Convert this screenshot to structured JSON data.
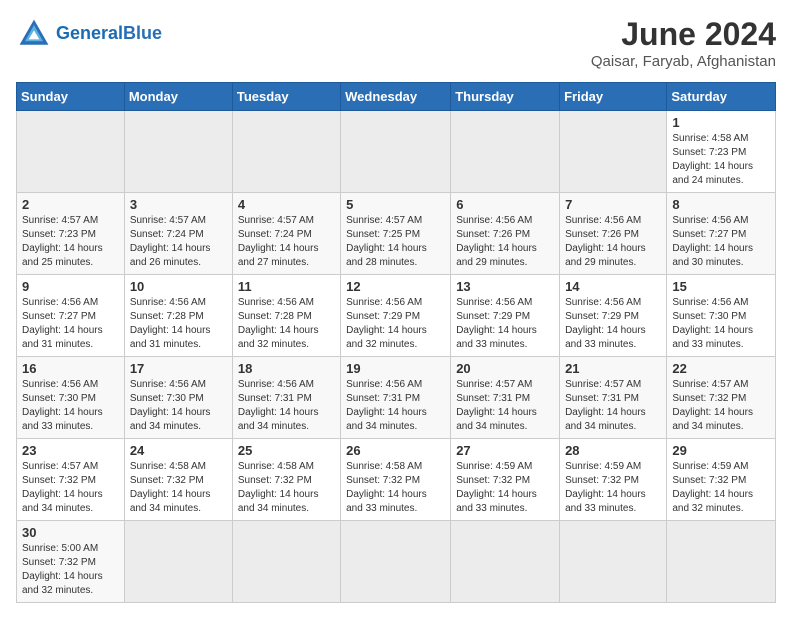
{
  "header": {
    "logo_general": "General",
    "logo_blue": "Blue",
    "month_year": "June 2024",
    "location": "Qaisar, Faryab, Afghanistan"
  },
  "weekdays": [
    "Sunday",
    "Monday",
    "Tuesday",
    "Wednesday",
    "Thursday",
    "Friday",
    "Saturday"
  ],
  "weeks": [
    [
      {
        "day": "",
        "info": ""
      },
      {
        "day": "",
        "info": ""
      },
      {
        "day": "",
        "info": ""
      },
      {
        "day": "",
        "info": ""
      },
      {
        "day": "",
        "info": ""
      },
      {
        "day": "",
        "info": ""
      },
      {
        "day": "1",
        "info": "Sunrise: 4:58 AM\nSunset: 7:23 PM\nDaylight: 14 hours\nand 24 minutes."
      }
    ],
    [
      {
        "day": "2",
        "info": "Sunrise: 4:57 AM\nSunset: 7:23 PM\nDaylight: 14 hours\nand 25 minutes."
      },
      {
        "day": "3",
        "info": "Sunrise: 4:57 AM\nSunset: 7:24 PM\nDaylight: 14 hours\nand 26 minutes."
      },
      {
        "day": "4",
        "info": "Sunrise: 4:57 AM\nSunset: 7:24 PM\nDaylight: 14 hours\nand 27 minutes."
      },
      {
        "day": "5",
        "info": "Sunrise: 4:57 AM\nSunset: 7:25 PM\nDaylight: 14 hours\nand 28 minutes."
      },
      {
        "day": "6",
        "info": "Sunrise: 4:56 AM\nSunset: 7:26 PM\nDaylight: 14 hours\nand 29 minutes."
      },
      {
        "day": "7",
        "info": "Sunrise: 4:56 AM\nSunset: 7:26 PM\nDaylight: 14 hours\nand 29 minutes."
      },
      {
        "day": "8",
        "info": "Sunrise: 4:56 AM\nSunset: 7:27 PM\nDaylight: 14 hours\nand 30 minutes."
      }
    ],
    [
      {
        "day": "9",
        "info": "Sunrise: 4:56 AM\nSunset: 7:27 PM\nDaylight: 14 hours\nand 31 minutes."
      },
      {
        "day": "10",
        "info": "Sunrise: 4:56 AM\nSunset: 7:28 PM\nDaylight: 14 hours\nand 31 minutes."
      },
      {
        "day": "11",
        "info": "Sunrise: 4:56 AM\nSunset: 7:28 PM\nDaylight: 14 hours\nand 32 minutes."
      },
      {
        "day": "12",
        "info": "Sunrise: 4:56 AM\nSunset: 7:29 PM\nDaylight: 14 hours\nand 32 minutes."
      },
      {
        "day": "13",
        "info": "Sunrise: 4:56 AM\nSunset: 7:29 PM\nDaylight: 14 hours\nand 33 minutes."
      },
      {
        "day": "14",
        "info": "Sunrise: 4:56 AM\nSunset: 7:29 PM\nDaylight: 14 hours\nand 33 minutes."
      },
      {
        "day": "15",
        "info": "Sunrise: 4:56 AM\nSunset: 7:30 PM\nDaylight: 14 hours\nand 33 minutes."
      }
    ],
    [
      {
        "day": "16",
        "info": "Sunrise: 4:56 AM\nSunset: 7:30 PM\nDaylight: 14 hours\nand 33 minutes."
      },
      {
        "day": "17",
        "info": "Sunrise: 4:56 AM\nSunset: 7:30 PM\nDaylight: 14 hours\nand 34 minutes."
      },
      {
        "day": "18",
        "info": "Sunrise: 4:56 AM\nSunset: 7:31 PM\nDaylight: 14 hours\nand 34 minutes."
      },
      {
        "day": "19",
        "info": "Sunrise: 4:56 AM\nSunset: 7:31 PM\nDaylight: 14 hours\nand 34 minutes."
      },
      {
        "day": "20",
        "info": "Sunrise: 4:57 AM\nSunset: 7:31 PM\nDaylight: 14 hours\nand 34 minutes."
      },
      {
        "day": "21",
        "info": "Sunrise: 4:57 AM\nSunset: 7:31 PM\nDaylight: 14 hours\nand 34 minutes."
      },
      {
        "day": "22",
        "info": "Sunrise: 4:57 AM\nSunset: 7:32 PM\nDaylight: 14 hours\nand 34 minutes."
      }
    ],
    [
      {
        "day": "23",
        "info": "Sunrise: 4:57 AM\nSunset: 7:32 PM\nDaylight: 14 hours\nand 34 minutes."
      },
      {
        "day": "24",
        "info": "Sunrise: 4:58 AM\nSunset: 7:32 PM\nDaylight: 14 hours\nand 34 minutes."
      },
      {
        "day": "25",
        "info": "Sunrise: 4:58 AM\nSunset: 7:32 PM\nDaylight: 14 hours\nand 34 minutes."
      },
      {
        "day": "26",
        "info": "Sunrise: 4:58 AM\nSunset: 7:32 PM\nDaylight: 14 hours\nand 33 minutes."
      },
      {
        "day": "27",
        "info": "Sunrise: 4:59 AM\nSunset: 7:32 PM\nDaylight: 14 hours\nand 33 minutes."
      },
      {
        "day": "28",
        "info": "Sunrise: 4:59 AM\nSunset: 7:32 PM\nDaylight: 14 hours\nand 33 minutes."
      },
      {
        "day": "29",
        "info": "Sunrise: 4:59 AM\nSunset: 7:32 PM\nDaylight: 14 hours\nand 32 minutes."
      }
    ],
    [
      {
        "day": "30",
        "info": "Sunrise: 5:00 AM\nSunset: 7:32 PM\nDaylight: 14 hours\nand 32 minutes."
      },
      {
        "day": "",
        "info": ""
      },
      {
        "day": "",
        "info": ""
      },
      {
        "day": "",
        "info": ""
      },
      {
        "day": "",
        "info": ""
      },
      {
        "day": "",
        "info": ""
      },
      {
        "day": "",
        "info": ""
      }
    ]
  ]
}
